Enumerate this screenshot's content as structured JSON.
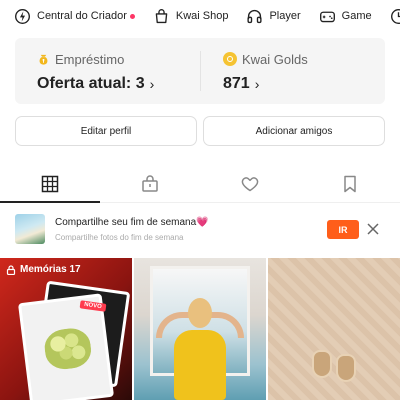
{
  "top_chips": [
    {
      "label": "Central do Criador",
      "icon": "lightning-icon",
      "has_badge": true
    },
    {
      "label": "Kwai Shop",
      "icon": "shopping-bag-icon"
    },
    {
      "label": "Player",
      "icon": "headphones-icon"
    },
    {
      "label": "Game",
      "icon": "gamepad-icon"
    }
  ],
  "stats": {
    "loan": {
      "title": "Empréstimo",
      "value": "Oferta atual: 3",
      "chevron": "›"
    },
    "golds": {
      "title": "Kwai Golds",
      "value": "871",
      "chevron": "›"
    }
  },
  "actions": {
    "edit_profile": "Editar perfil",
    "add_friends": "Adicionar amigos"
  },
  "tabs": {
    "active": "grid",
    "icons": [
      "grid-icon",
      "lock-bag-icon",
      "heart-icon",
      "bookmark-icon"
    ]
  },
  "promo": {
    "title": "Compartilhe seu fim de semana",
    "heart": "💗",
    "subtitle": "Compartilhe fotos do fim de semana",
    "cta": "IR",
    "close": "✕"
  },
  "grid": {
    "memories_label": "Memórias 17",
    "badge_new": "NOVO"
  },
  "colors": {
    "accent": "#ff5e1a",
    "badge_red": "#fe3666",
    "coin_gold": "#f5c332",
    "loan_icon": "#f2b71c"
  }
}
